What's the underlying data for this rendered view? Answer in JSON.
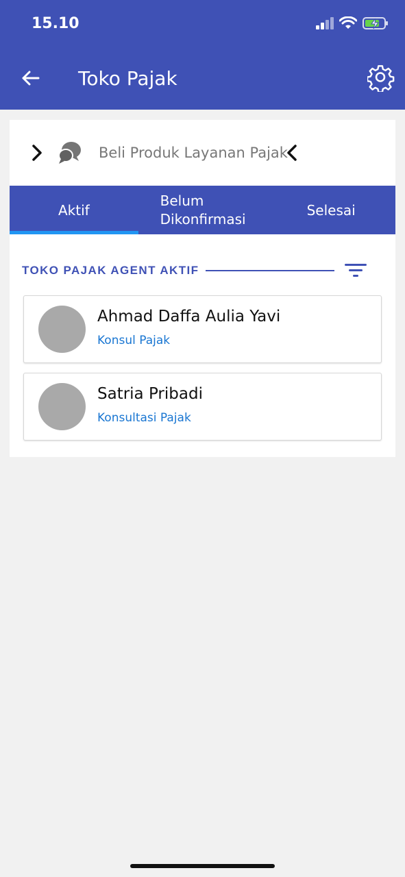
{
  "status_bar": {
    "time": "15.10",
    "icons": [
      "signal-icon",
      "wifi-icon",
      "battery-charging-icon"
    ]
  },
  "app_bar": {
    "title": "Toko Pajak",
    "back_icon": "arrow-left-icon",
    "settings_icon": "gear-icon"
  },
  "promo": {
    "label": "Beli Produk Layanan Pajak",
    "icons": [
      "chevron-right-icon",
      "chat-bubbles-icon",
      "chevron-left-icon"
    ]
  },
  "tabs": [
    {
      "label": "Aktif",
      "active": true
    },
    {
      "label_line1": "Belum",
      "label_line2": "Dikonfirmasi",
      "active": false
    },
    {
      "label": "Selesai",
      "active": false
    }
  ],
  "section": {
    "title": "TOKO PAJAK AGENT AKTIF",
    "filter_icon": "filter-icon"
  },
  "agents": [
    {
      "name": "Ahmad Daffa Aulia Yavi",
      "role": "Konsul Pajak"
    },
    {
      "name": "Satria Pribadi",
      "role": "Konsultasi Pajak"
    }
  ],
  "colors": {
    "primary": "#3f51b5",
    "tab_indicator": "#2196f3",
    "link": "#1976d2",
    "avatar": "#a9a9a9",
    "background": "#f1f1f1"
  }
}
